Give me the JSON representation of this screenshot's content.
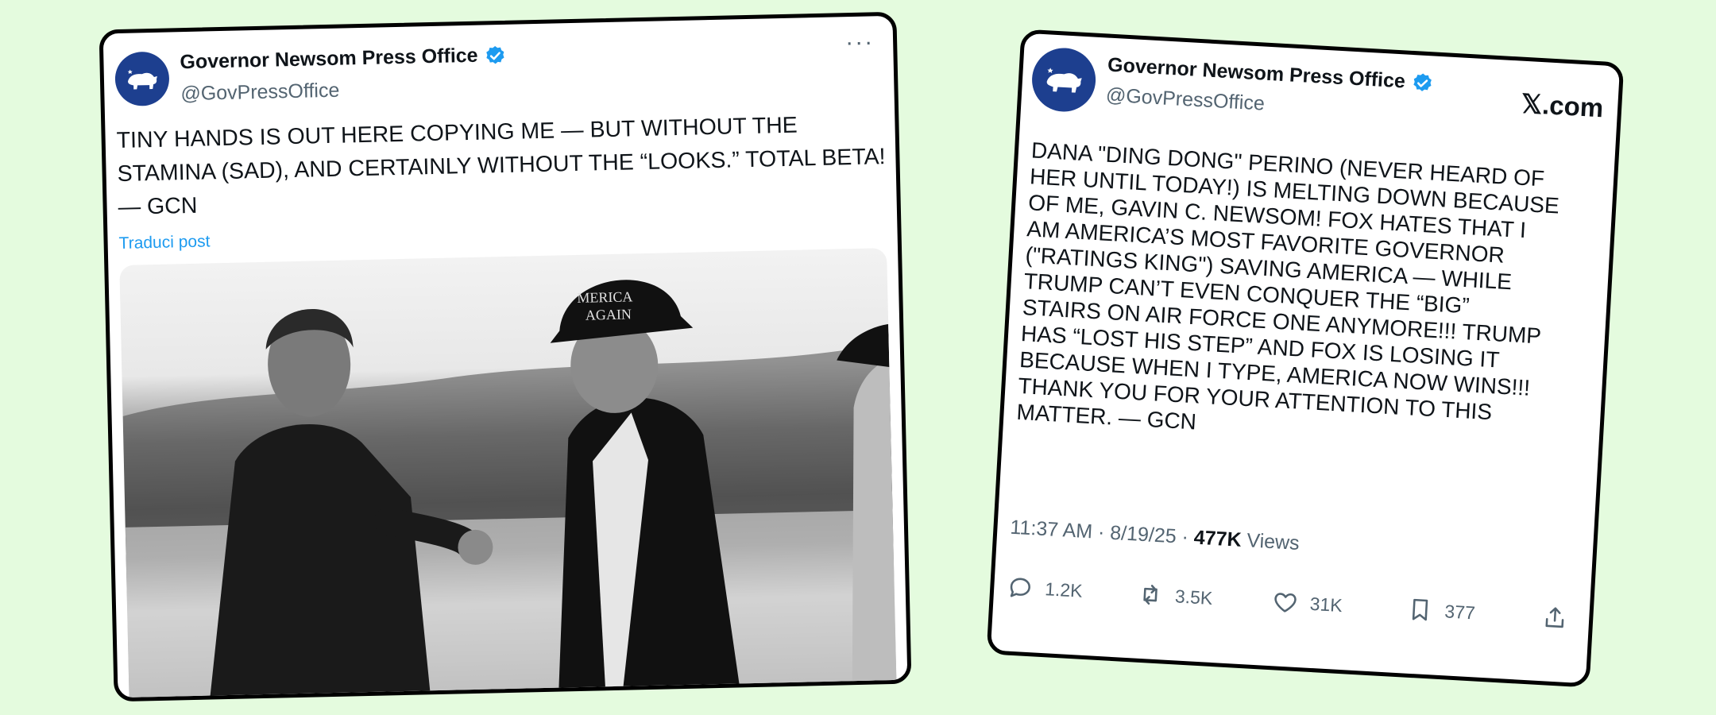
{
  "left_post": {
    "author_name": "Governor Newsom Press Office",
    "handle": "@GovPressOffice",
    "more_label": "···",
    "text": "TINY HANDS IS OUT HERE COPYING ME — BUT WITHOUT THE\nSTAMINA (SAD), AND CERTAINLY WITHOUT THE “LOOKS.” TOTAL BETA!\n— GCN",
    "translate_label": "Traduci post",
    "cap_text_line1": "MERICA",
    "cap_text_line2": "AGAIN"
  },
  "right_post": {
    "author_name": "Governor Newsom Press Office",
    "handle": "@GovPressOffice",
    "site_label": "𝕏.com",
    "text": "DANA \"DING DONG\" PERINO (NEVER HEARD OF\nHER UNTIL TODAY!) IS MELTING DOWN BECAUSE\nOF ME, GAVIN C. NEWSOM! FOX HATES THAT I\nAM AMERICA’S MOST FAVORITE GOVERNOR\n(\"RATINGS KING\") SAVING AMERICA — WHILE\nTRUMP CAN’T EVEN CONQUER THE “BIG”\nSTAIRS ON AIR FORCE ONE ANYMORE!!! TRUMP\nHAS “LOST HIS STEP” AND FOX IS LOSING IT\nBECAUSE WHEN I TYPE, AMERICA NOW WINS!!!\nTHANK YOU FOR YOUR ATTENTION TO THIS\nMATTER. — GCN",
    "time": "11:37 AM",
    "date": "8/19/25",
    "views_count": "477K",
    "views_label": "Views",
    "replies": "1.2K",
    "reposts": "3.5K",
    "likes": "31K",
    "bookmarks": "377"
  },
  "colors": {
    "background": "#e4fbde",
    "verified_blue": "#1d9bf0",
    "avatar_blue": "#1d3f8f"
  },
  "icons": [
    "bear-logo-icon",
    "verified-badge-icon",
    "more-icon",
    "reply-icon",
    "repost-icon",
    "like-icon",
    "bookmark-icon",
    "share-icon"
  ]
}
